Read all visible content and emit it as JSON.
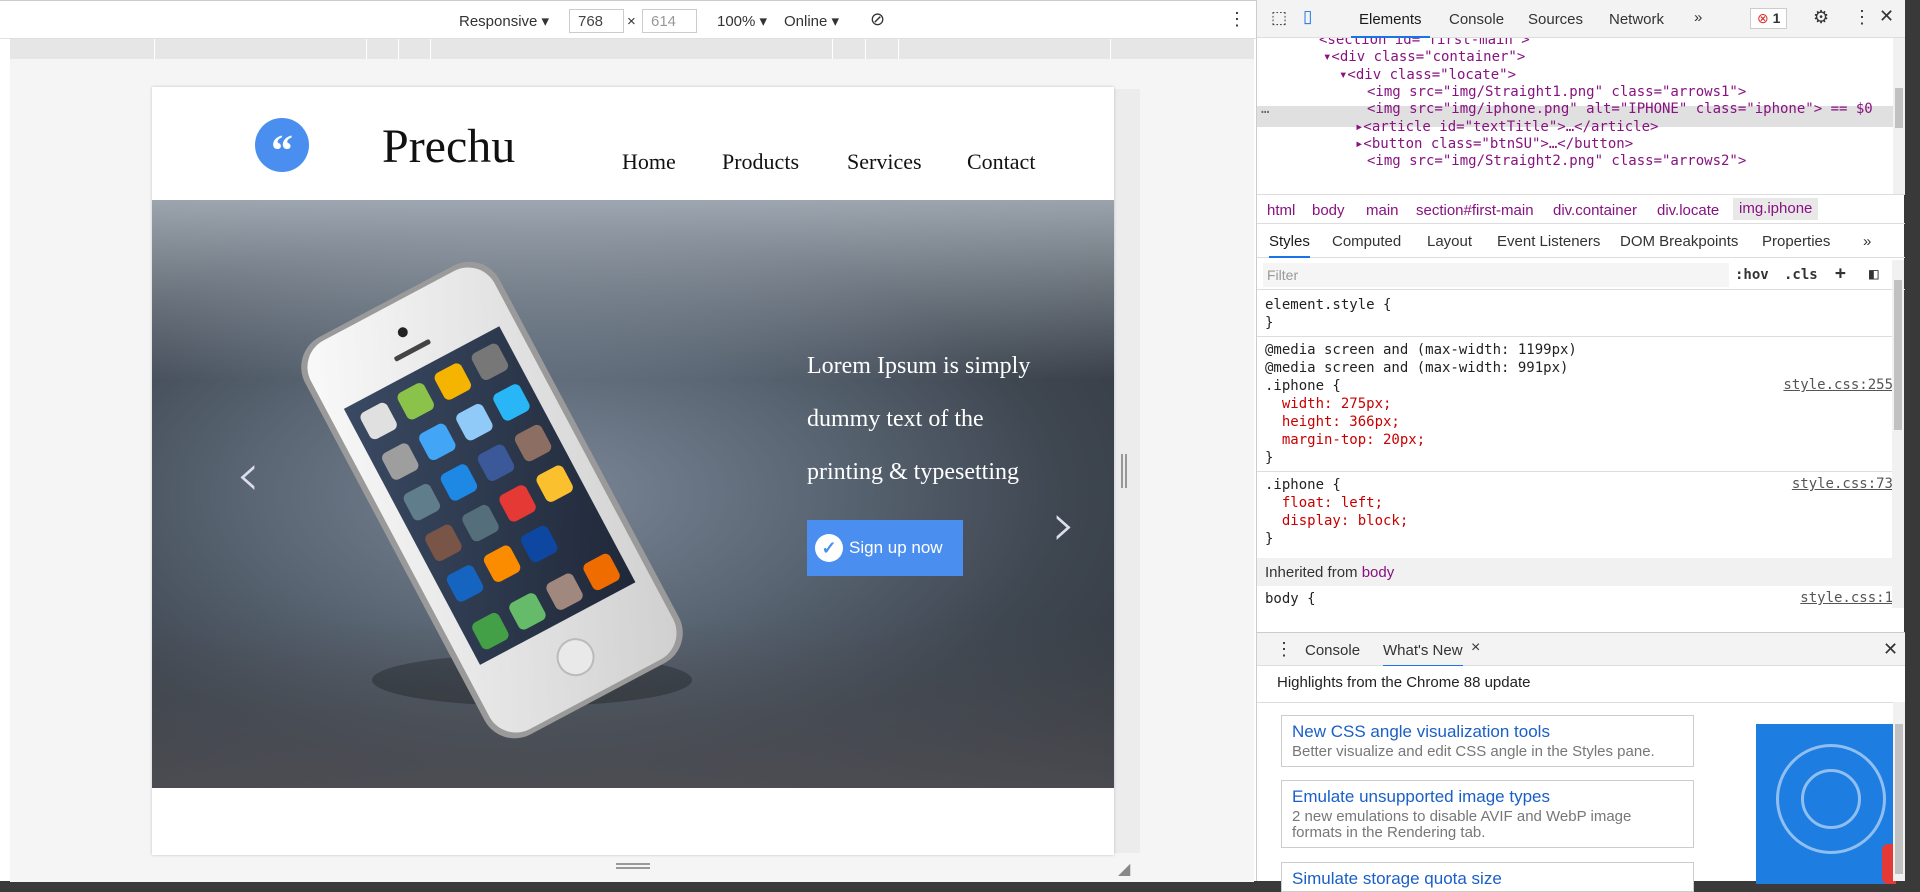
{
  "toolbar": {
    "device": "Responsive",
    "width": "768",
    "height": "614",
    "times": "×",
    "zoom": "100%",
    "throttle": "Online"
  },
  "site": {
    "logo_glyph": "“",
    "brand": "Prechu",
    "nav": [
      "Home",
      "Products",
      "Services",
      "Contact"
    ],
    "hero_text_lines": [
      "Lorem Ipsum is simply",
      "dummy text of the",
      "printing & typesetting"
    ],
    "signup": "Sign up now",
    "prev": "‹",
    "next": "›"
  },
  "devtools": {
    "tabs": [
      "Elements",
      "Console",
      "Sources",
      "Network"
    ],
    "more": "»",
    "error_count": "1",
    "dom": [
      {
        "indent": 0,
        "text": "<section id=\"first-main\">"
      },
      {
        "indent": 1,
        "text": "▾<div class=\"container\">"
      },
      {
        "indent": 2,
        "text": "▾<div class=\"locate\">"
      },
      {
        "indent": 3,
        "text": "<img src=\"img/Straight1.png\" class=\"arrows1\">"
      },
      {
        "indent": 3,
        "text": "<img src=\"img/iphone.png\" alt=\"IPHONE\" class=\"iphone\"> == $0"
      },
      {
        "indent": 3,
        "text": "▸<article id=\"textTitle\">…</article>"
      },
      {
        "indent": 3,
        "text": "▸<button class=\"btnSU\">…</button>"
      },
      {
        "indent": 3,
        "text": "<img src=\"img/Straight2.png\" class=\"arrows2\">"
      }
    ],
    "dots": "…",
    "breadcrumbs": [
      "html",
      "body",
      "main",
      "section#first-main",
      "div.container",
      "div.locate",
      "img.iphone"
    ],
    "subtabs": [
      "Styles",
      "Computed",
      "Layout",
      "Event Listeners",
      "DOM Breakpoints",
      "Properties",
      "»"
    ],
    "filter_placeholder": "Filter",
    "hov": ":hov",
    "cls": ".cls",
    "plus": "+",
    "styles": [
      "element.style {",
      "}",
      "@media screen and (max-width: 1199px)",
      "@media screen and (max-width: 991px)",
      ".iphone {",
      "  width: 275px;",
      "  height: 366px;",
      "  margin-top: 20px;",
      "}",
      ".iphone {",
      "  float: left;",
      "  display: block;",
      "}"
    ],
    "src1": "style.css:255",
    "src2": "style.css:73",
    "src3": "style.css:1",
    "inherited_label": "Inherited from",
    "inherited_from": "body",
    "body_rule": "body {",
    "drawer_tabs": [
      "Console",
      "What's New"
    ],
    "drawer_close": "×",
    "whatsnew_title": "Highlights from the Chrome 88 update",
    "cards": [
      {
        "title": "New CSS angle visualization tools",
        "desc": "Better visualize and edit CSS angle in the Styles pane."
      },
      {
        "title": "Emulate unsupported image types",
        "desc": "2 new emulations to disable AVIF and WebP image formats in the Rendering tab."
      },
      {
        "title": "Simulate storage quota size",
        "desc": ""
      }
    ]
  }
}
